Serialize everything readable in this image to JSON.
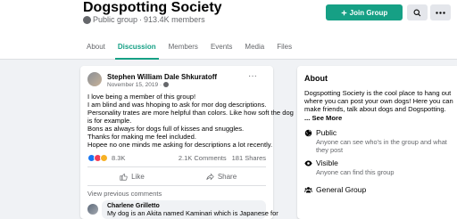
{
  "header": {
    "title": "Dogspotting Society",
    "privacy": "Public group",
    "separator": "·",
    "members": "913.4K members",
    "join_label": "Join Group",
    "join_icon": "plus-icon",
    "tabs": [
      {
        "label": "About",
        "active": false
      },
      {
        "label": "Discussion",
        "active": true
      },
      {
        "label": "Members",
        "active": false
      },
      {
        "label": "Events",
        "active": false
      },
      {
        "label": "Media",
        "active": false
      },
      {
        "label": "Files",
        "active": false
      }
    ],
    "accent_color": "#16a085"
  },
  "post": {
    "author": "Stephen William Dale Shkuratoff",
    "date": "November 15, 2019 · ",
    "lines": [
      "I love being a member of this group!",
      "I am blind and was hhoping to ask for mor dog descriptions.",
      "Personality trates are more helpful than colors. Like how soft the dog",
      "is for example.",
      "Bons as always for dogs full of kisses and snuggles.",
      "Thanks for making me feel included.",
      "Hopee no one minds me asking for descriptions a lot recently."
    ],
    "reaction_count": "8.3K",
    "comments": "2.1K Comments",
    "shares": "181 Shares",
    "like_label": "Like",
    "share_label": "Share",
    "view_previous": "View previous comments",
    "comment": {
      "author": "Charlene Grilletto",
      "text": "My dog is an Akita named Kaminari which is Japanese for"
    }
  },
  "about": {
    "title": "About",
    "desc_lines": [
      "Dogspotting Society is the cool place to hang out",
      "where you can post your own dogs! Here you can",
      "make friends, talk about dogs and Dogspotting."
    ],
    "see_more": "... See More",
    "items": [
      {
        "icon": "globe-icon",
        "label": "Public",
        "sub": [
          "Anyone can see who's in the group and what",
          "they post"
        ]
      },
      {
        "icon": "eye-icon",
        "label": "Visible",
        "sub": [
          "Anyone can find this group"
        ]
      },
      {
        "icon": "people-icon",
        "label": "General Group",
        "sub": []
      }
    ]
  }
}
